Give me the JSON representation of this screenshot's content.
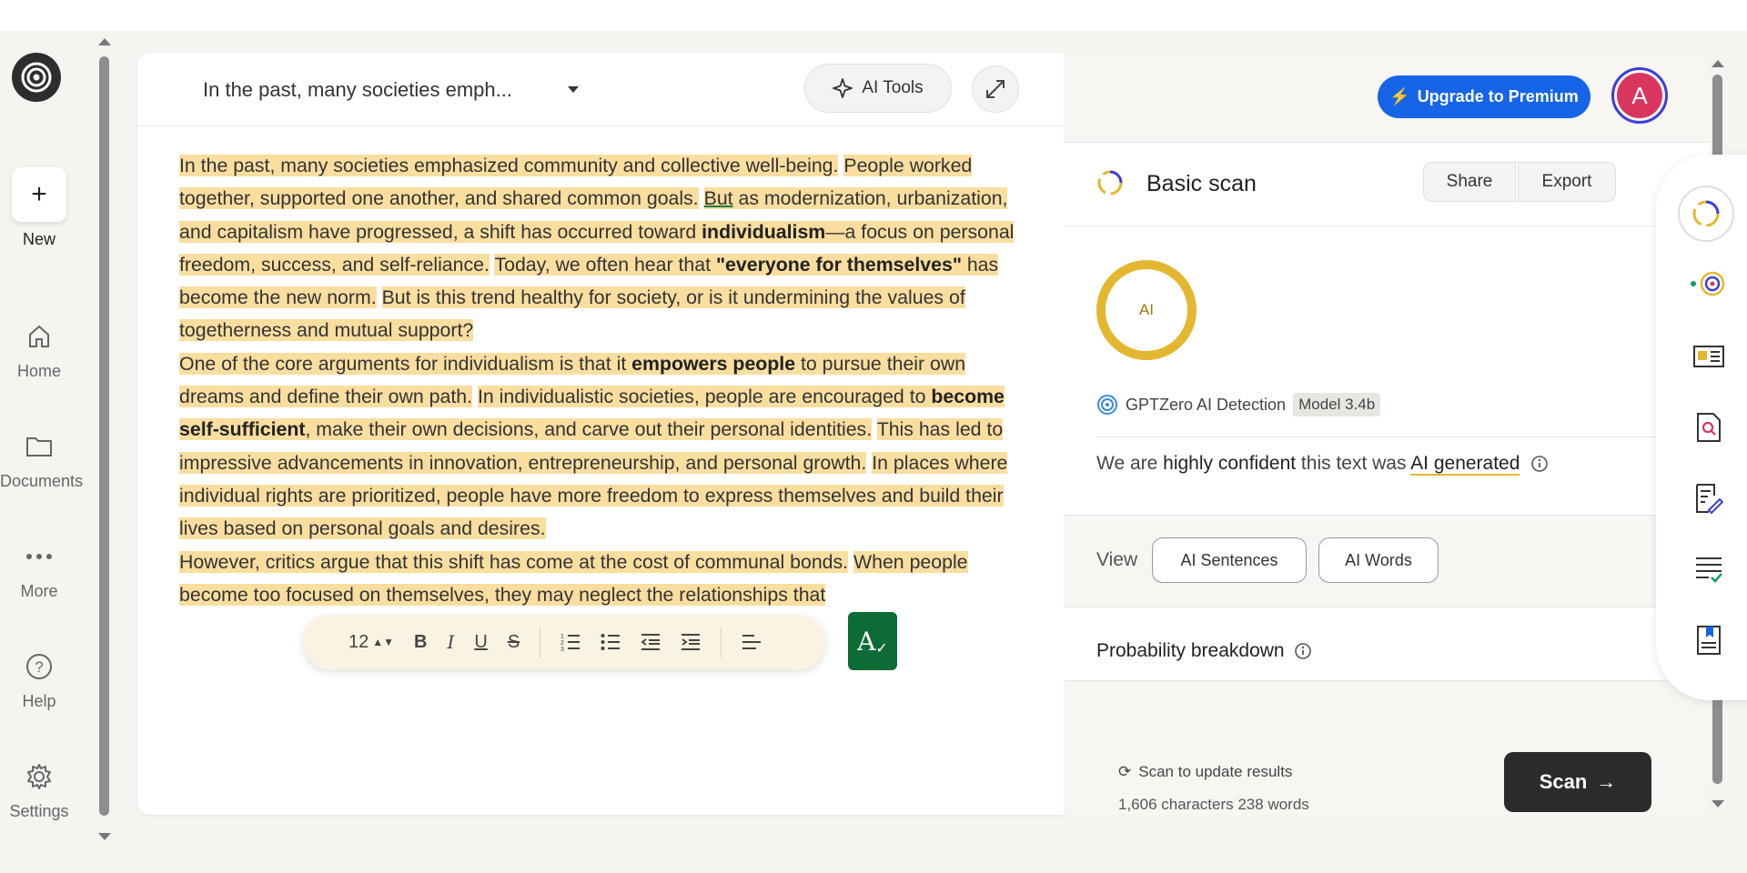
{
  "nav": {
    "new_label": "New",
    "items": [
      {
        "label": "Home",
        "icon": "home-icon"
      },
      {
        "label": "Documents",
        "icon": "folder-icon"
      },
      {
        "label": "More",
        "icon": "more-icon"
      },
      {
        "label": "Help",
        "icon": "help-icon"
      },
      {
        "label": "Settings",
        "icon": "gear-icon"
      }
    ]
  },
  "editor": {
    "doc_title": "In the past, many societies emph...",
    "ai_tools_label": "AI Tools",
    "paragraphs": {
      "p1": {
        "s1": "In the past, many societies emphasized community and collective well-being.",
        "s2": "People worked together, supported one another, and shared common goals.",
        "s3_a": "But",
        "s3_b": " as modernization, urbanization, and capitalism have progressed, a shift has occurred toward ",
        "s3_bold": "individualism",
        "s3_c": "—a focus on personal freedom, success, and self-reliance.",
        "s4_a": "Today, we often hear that ",
        "s4_bold": "\"everyone for themselves\"",
        "s4_b": " has become the new norm.",
        "s5": "But is this trend healthy for society, or is it undermining the values of togetherness and mutual support?"
      },
      "p2": {
        "s1_a": "One of the core arguments for individualism is that it ",
        "s1_bold": "empowers people",
        "s1_b": " to pursue their own dreams and define their own path.",
        "s2_a": "In individualistic societies, people are encouraged to ",
        "s2_bold": "become self-sufficient",
        "s2_b": ", make their own decisions, and carve out their personal identities.",
        "s3": "This has led to impressive advancements in innovation, entrepreneurship, and personal growth.",
        "s4": "In places where individual rights are prioritized, people have more freedom to express themselves and build their lives based on personal goals and desires."
      },
      "p3": {
        "s1": "However, critics argue that this shift has come at the cost of communal bonds.",
        "s2": "When people become too focused on themselves, they may neglect the relationships that"
      }
    },
    "format_bar": {
      "font_size": "12",
      "bold": "B",
      "italic": "I",
      "underline": "U",
      "strike": "S"
    },
    "spell_label": "A"
  },
  "panel": {
    "upgrade_label": "Upgrade to Premium",
    "avatar_letter": "A",
    "scan_title": "Basic scan",
    "share_label": "Share",
    "export_label": "Export",
    "ring_label": "AI",
    "detector_label": "GPTZero AI Detection",
    "model_badge": "Model 3.4b",
    "confidence": {
      "pre": "We are ",
      "strong": "highly confident",
      "mid": " this text was ",
      "result": "AI generated"
    },
    "view_label": "View",
    "view_buttons": [
      "AI Sentences",
      "AI Words"
    ],
    "probability_label": "Probability breakdown",
    "rescan_label": "Scan to update results",
    "counts": "1,606 characters 238 words",
    "scan_button": "Scan"
  },
  "colors": {
    "highlight": "#f9dea0",
    "ai_ring": "#e4b730",
    "upgrade": "#1664e8",
    "avatar": "#d9365f",
    "spell": "#0d6b35"
  }
}
